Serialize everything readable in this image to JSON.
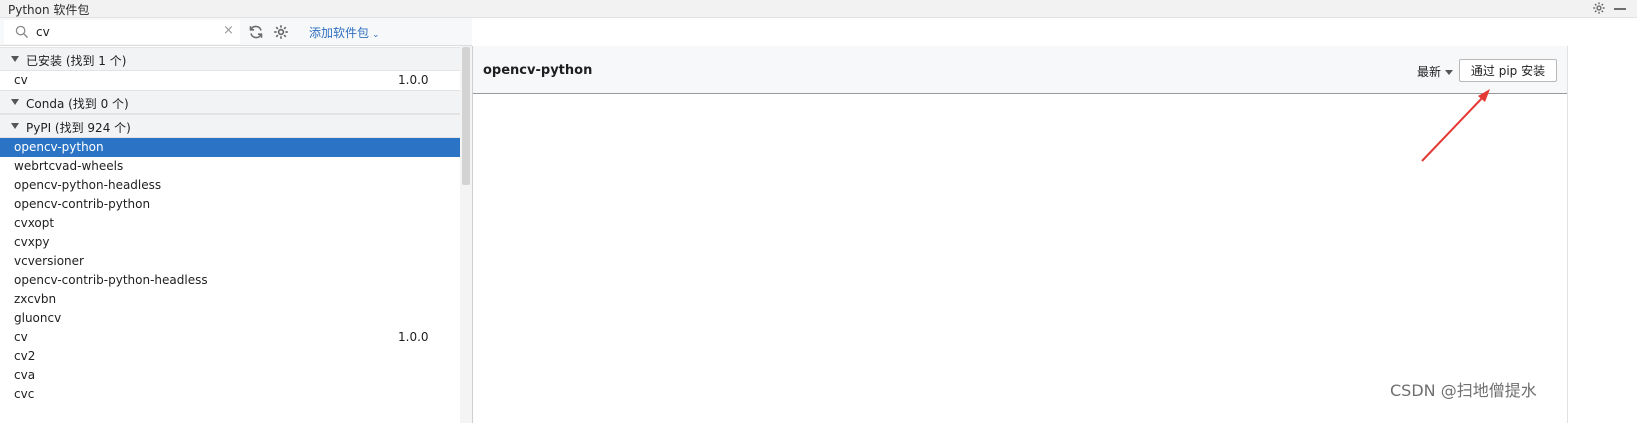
{
  "window": {
    "title": "Python 软件包"
  },
  "toolbar": {
    "search_value": "cv",
    "clear_glyph": "×",
    "add_package_label": "添加软件包",
    "add_package_chevron": "⌄"
  },
  "groups": {
    "installed": {
      "label": "已安装 (找到 1 个)",
      "items": [
        {
          "name": "cv",
          "version": "1.0.0"
        }
      ]
    },
    "conda": {
      "label": "Conda (找到 0 个)"
    },
    "pypi": {
      "label": "PyPI (找到 924 个)",
      "items": [
        {
          "name": "opencv-python",
          "version": ""
        },
        {
          "name": "webrtcvad-wheels",
          "version": ""
        },
        {
          "name": "opencv-python-headless",
          "version": ""
        },
        {
          "name": "opencv-contrib-python",
          "version": ""
        },
        {
          "name": "cvxopt",
          "version": ""
        },
        {
          "name": "cvxpy",
          "version": ""
        },
        {
          "name": "vcversioner",
          "version": ""
        },
        {
          "name": "opencv-contrib-python-headless",
          "version": ""
        },
        {
          "name": "zxcvbn",
          "version": ""
        },
        {
          "name": "gluoncv",
          "version": ""
        },
        {
          "name": "cv",
          "version": "1.0.0"
        },
        {
          "name": "cv2",
          "version": ""
        },
        {
          "name": "cva",
          "version": ""
        },
        {
          "name": "cvc",
          "version": ""
        }
      ],
      "selected": "opencv-python"
    }
  },
  "details": {
    "package_title": "opencv-python",
    "version_select": "最新",
    "install_button": "通过 pip 安装"
  },
  "watermark": "CSDN @扫地僧提水",
  "colors": {
    "selection": "#2a73c5",
    "link": "#2f6fc0",
    "annotation_arrow": "#e53935"
  },
  "icons": [
    "search-icon",
    "clear-icon",
    "refresh-icon",
    "gear-icon",
    "chevron-down-icon",
    "collapse-triangle-icon",
    "minimize-icon"
  ]
}
